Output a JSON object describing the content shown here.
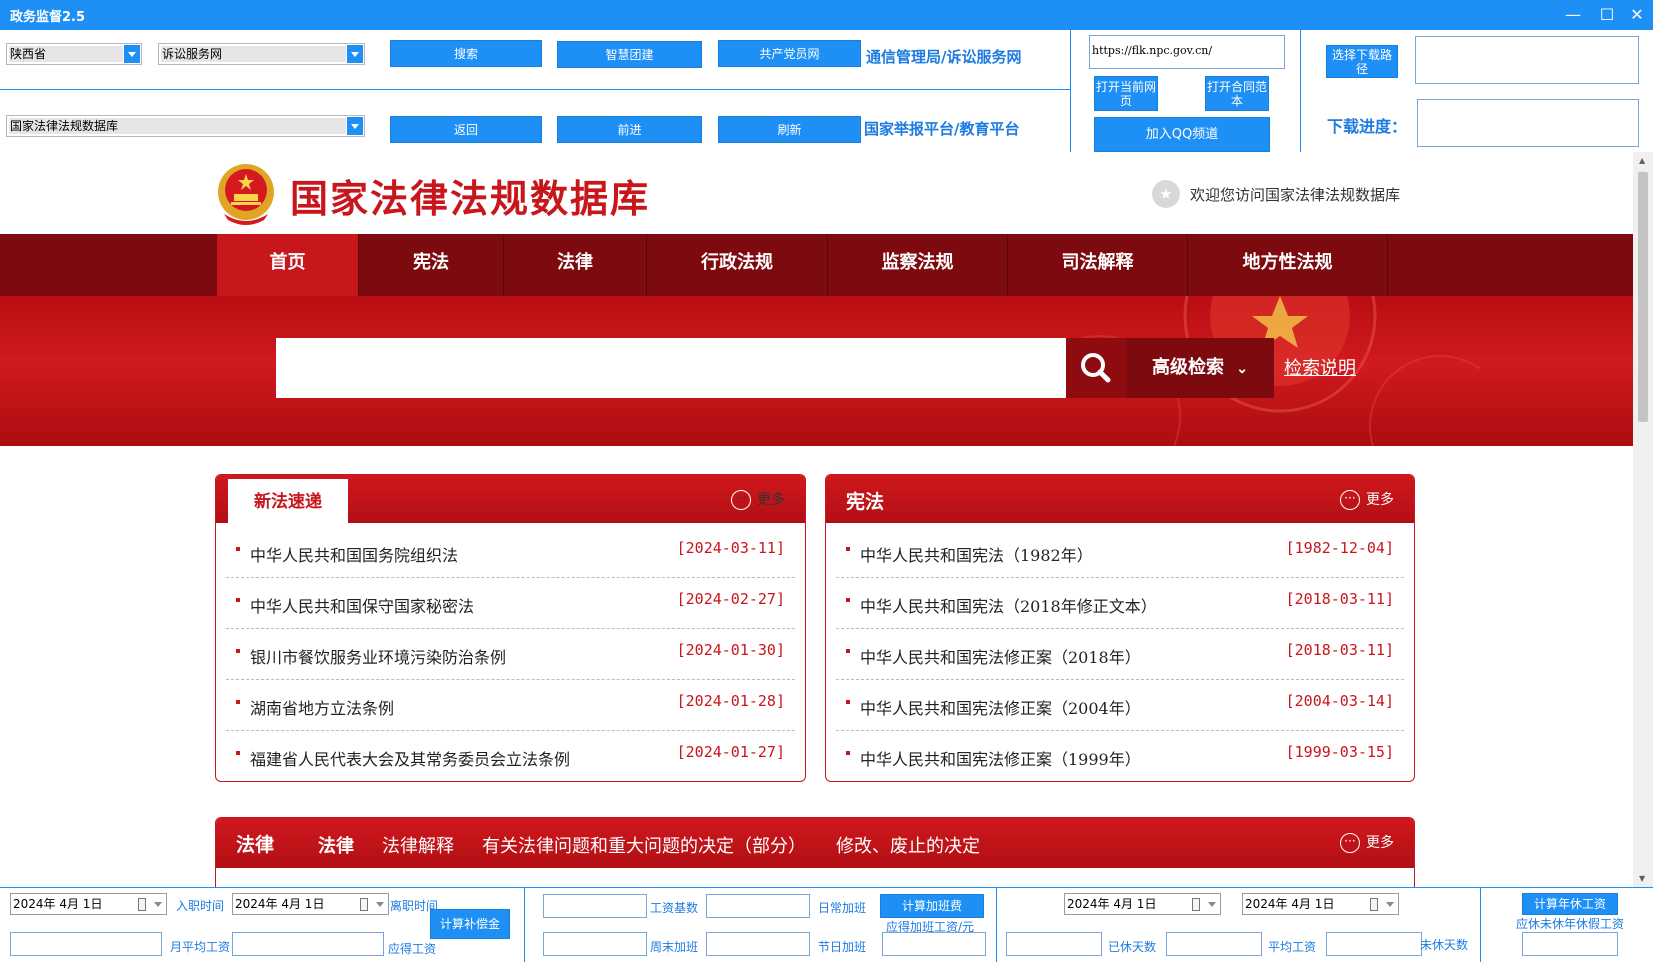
{
  "window": {
    "title": "政务监督2.5",
    "minimize": "—",
    "maximize": "☐",
    "close": "✕"
  },
  "toolbar": {
    "province_select": "陕西省",
    "service_select": "诉讼服务网",
    "database_select": "国家法律法规数据库",
    "buttons": {
      "search": "搜索",
      "smart_party": "智慧团建",
      "party_member": "共产党员网",
      "back": "返回",
      "forward": "前进",
      "refresh": "刷新"
    },
    "links": {
      "telecom": "通信管理局/诉讼服务网",
      "report": "国家举报平台/教育平台"
    },
    "url": "https://flk.npc.gov.cn/",
    "open_current": "打开当前网页",
    "open_contract": "打开合同范本",
    "join_qq": "加入QQ频道",
    "choose_download": "选择下载路径",
    "download_progress": "下载进度："
  },
  "site": {
    "title": "国家法律法规数据库",
    "welcome": "欢迎您访问国家法律法规数据库",
    "nav": [
      "首页",
      "宪法",
      "法律",
      "行政法规",
      "监察法规",
      "司法解释",
      "地方性法规"
    ],
    "search_placeholder": "",
    "advanced": "高级检索",
    "help": "检索说明",
    "more": "更多",
    "panels": {
      "new_laws": {
        "title": "新法速递",
        "items": [
          {
            "title": "中华人民共和国国务院组织法",
            "date": "[2024-03-11]"
          },
          {
            "title": "中华人民共和国保守国家秘密法",
            "date": "[2024-02-27]"
          },
          {
            "title": "银川市餐饮服务业环境污染防治条例",
            "date": "[2024-01-30]"
          },
          {
            "title": "湖南省地方立法条例",
            "date": "[2024-01-28]"
          },
          {
            "title": "福建省人民代表大会及其常务委员会立法条例",
            "date": "[2024-01-27]"
          }
        ]
      },
      "constitution": {
        "title": "宪法",
        "items": [
          {
            "title": "中华人民共和国宪法（1982年）",
            "date": "[1982-12-04]"
          },
          {
            "title": "中华人民共和国宪法（2018年修正文本）",
            "date": "[2018-03-11]"
          },
          {
            "title": "中华人民共和国宪法修正案（2018年）",
            "date": "[2018-03-11]"
          },
          {
            "title": "中华人民共和国宪法修正案（2004年）",
            "date": "[2004-03-14]"
          },
          {
            "title": "中华人民共和国宪法修正案（1999年）",
            "date": "[1999-03-15]"
          }
        ]
      },
      "law": {
        "title": "法律",
        "tabs": [
          "法律",
          "法律解释",
          "有关法律问题和重大问题的决定（部分）",
          "修改、废止的决定"
        ]
      }
    }
  },
  "calc": {
    "date1": "2024年 4月 1日",
    "date2": "2024年 4月 1日",
    "date3": "2024年 4月 1日",
    "date4": "2024年 4月 1日",
    "hire_time": "入职时间",
    "leave_time": "离职时间",
    "calc_compensation": "计算补偿金",
    "monthly_avg_wage": "月平均工资",
    "due_wage": "应得工资",
    "wage_base": "工资基数",
    "daily_overtime": "日常加班",
    "calc_overtime": "计算加班费",
    "due_overtime": "应得加班工资/元",
    "weekend_overtime": "周末加班",
    "holiday_overtime": "节日加班",
    "rested_days": "已休天数",
    "avg_wage": "平均工资",
    "unrested_days": "未休天数",
    "calc_annual": "计算年休工资",
    "due_annual": "应休未休年休假工资"
  }
}
